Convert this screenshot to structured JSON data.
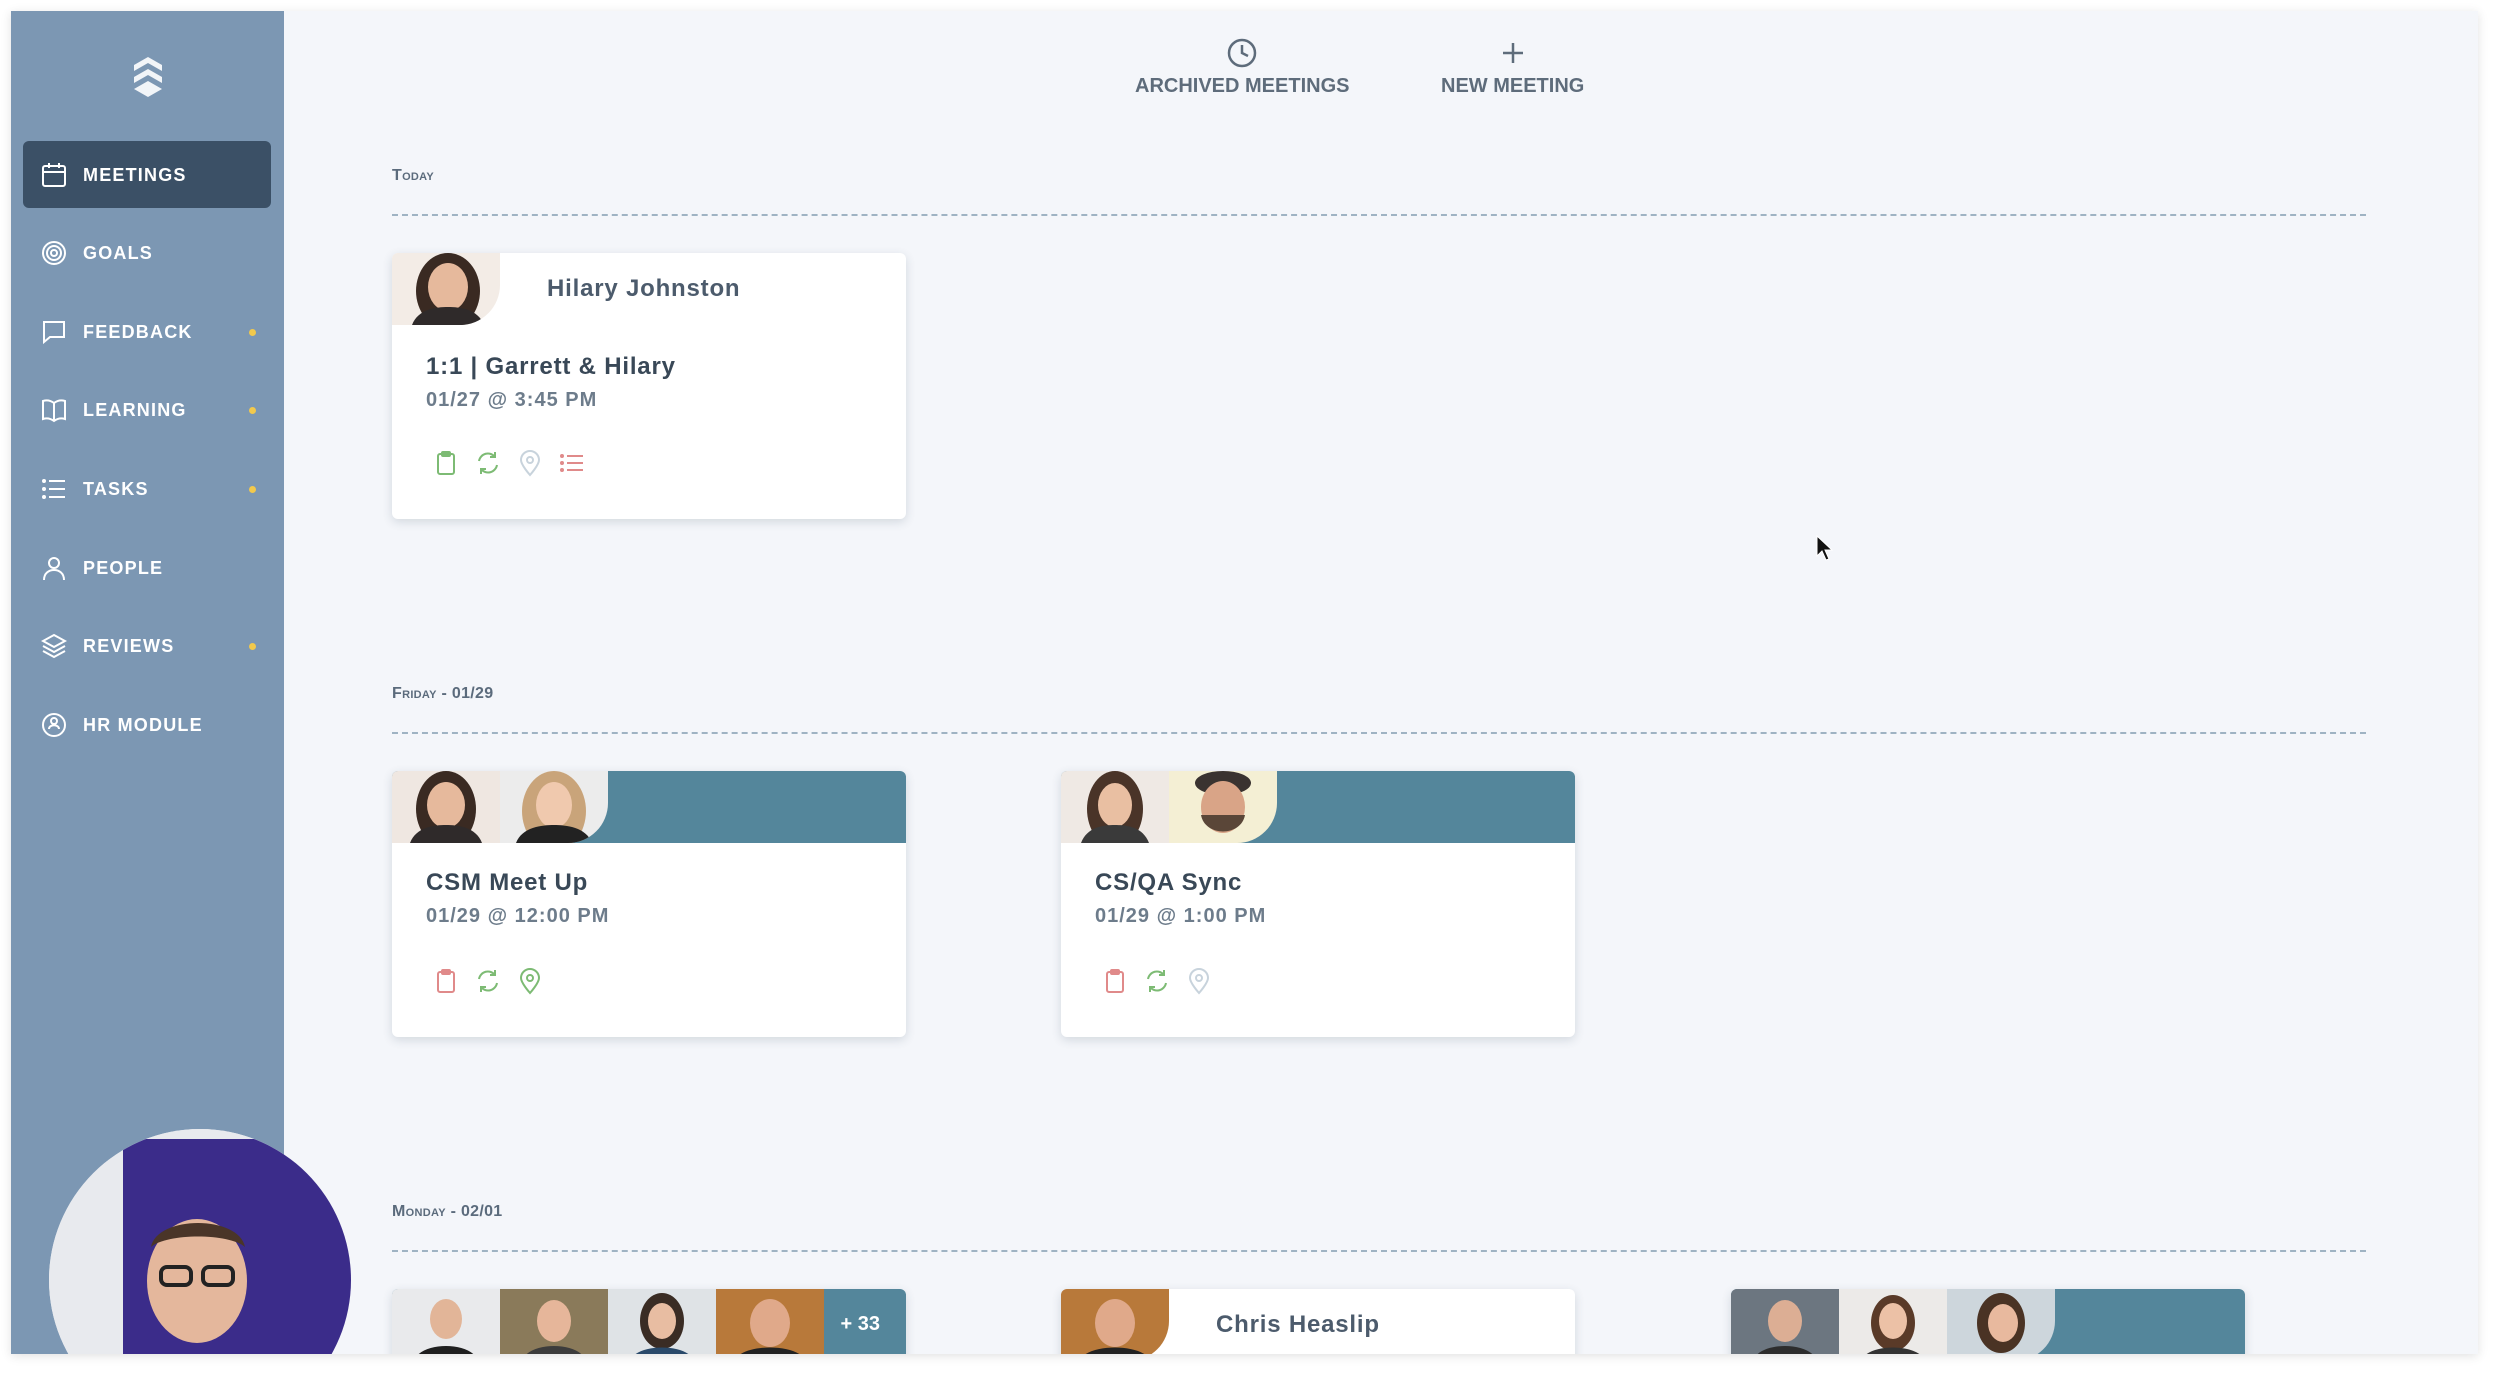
{
  "nav": {
    "items": [
      {
        "label": "MEETINGS",
        "icon": "calendar-icon",
        "active": true,
        "dot": false
      },
      {
        "label": "GOALS",
        "icon": "target-icon",
        "active": false,
        "dot": false
      },
      {
        "label": "FEEDBACK",
        "icon": "chat-icon",
        "active": false,
        "dot": true
      },
      {
        "label": "LEARNING",
        "icon": "book-icon",
        "active": false,
        "dot": true
      },
      {
        "label": "TASKS",
        "icon": "list-icon",
        "active": false,
        "dot": true
      },
      {
        "label": "PEOPLE",
        "icon": "person-icon",
        "active": false,
        "dot": false
      },
      {
        "label": "REVIEWS",
        "icon": "layers-icon",
        "active": false,
        "dot": true
      },
      {
        "label": "HR MODULE",
        "icon": "hr-module-icon",
        "active": false,
        "dot": false
      }
    ]
  },
  "top_actions": {
    "archived": "ARCHIVED MEETINGS",
    "new_meeting": "NEW MEETING"
  },
  "sections": [
    {
      "label": "Today",
      "cards": [
        {
          "name": "Hilary Johnston",
          "title": "1:1 | Garrett & Hilary",
          "time": "01/27 @ 3:45 PM",
          "icons": [
            "clipboard-icon",
            "sync-icon",
            "location-icon",
            "list-icon"
          ]
        }
      ]
    },
    {
      "label": "Friday - 01/29",
      "cards": [
        {
          "name": "",
          "title": "CSM Meet Up",
          "time": "01/29 @ 12:00 PM",
          "icons": [
            "clipboard-icon",
            "sync-icon",
            "location-icon"
          ]
        },
        {
          "name": "",
          "title": "CS/QA Sync",
          "time": "01/29 @ 1:00 PM",
          "icons": [
            "clipboard-icon",
            "sync-icon",
            "location-icon"
          ]
        }
      ]
    },
    {
      "label": "Monday - 02/01",
      "cards": [
        {
          "name": "",
          "more": "+ 33"
        },
        {
          "name": "Chris Heaslip"
        },
        {
          "name": ""
        }
      ]
    }
  ],
  "colors": {
    "sidebar": "#7c97b3",
    "sidebar_active": "#3b5066",
    "teal_header": "#54869b",
    "icon_green": "#7dbb74",
    "icon_red": "#e08a8a",
    "icon_muted": "#c8d3dc",
    "notification_dot": "#f2c94c"
  }
}
